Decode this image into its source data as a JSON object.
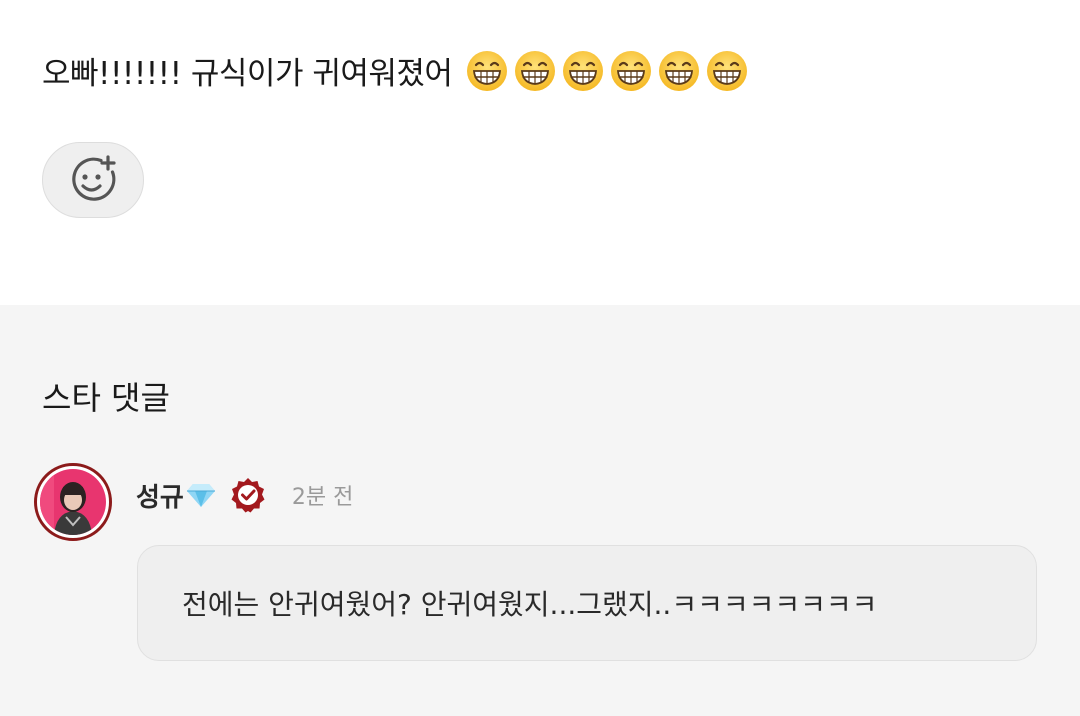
{
  "post": {
    "text": "오빠!!!!!!! 규식이가 귀여워졌어",
    "emoji_count": 6,
    "emoji_name": "grinning-face-with-smiling-eyes-icon",
    "reaction_button_icon": "add-reaction-icon"
  },
  "comments_section": {
    "title": "스타 댓글",
    "comment": {
      "username": "성규",
      "username_badge_icon": "gem-icon",
      "verified_icon": "verified-badge-icon",
      "timestamp": "2분 전",
      "text": "전에는 안귀여웠어? 안귀여웠지...그랬지..ㅋㅋㅋㅋㅋㅋㅋㅋ"
    }
  },
  "colors": {
    "avatar_ring": "#8c1b1b",
    "verified_badge": "#a3191e",
    "comments_bg": "#f5f5f5",
    "bubble_bg": "#efefef"
  }
}
